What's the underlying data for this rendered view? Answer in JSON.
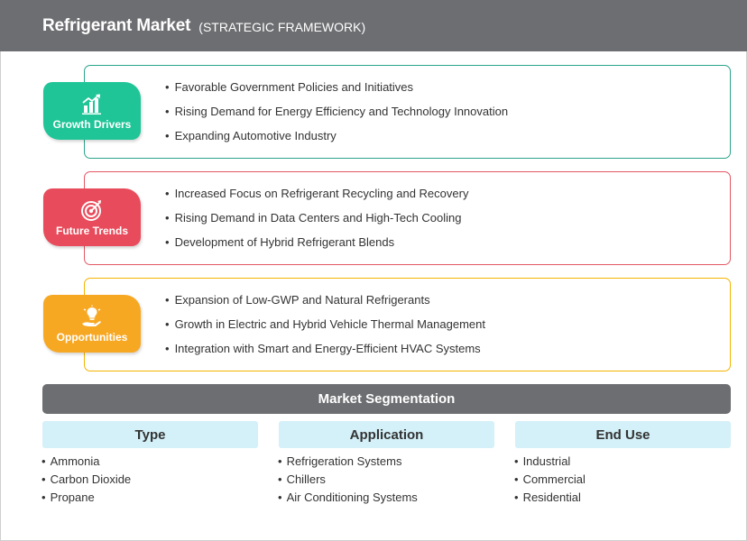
{
  "header": {
    "title": "Refrigerant Market",
    "subtitle": "(STRATEGIC FRAMEWORK)"
  },
  "sections": [
    {
      "label": "Growth Drivers",
      "icon": "growth-chart-icon",
      "color": "#1fc597",
      "border_color": "#2aa58a",
      "items": [
        "Favorable Government Policies and Initiatives",
        "Rising Demand for Energy Efficiency and Technology Innovation",
        "Expanding Automotive Industry"
      ]
    },
    {
      "label": "Future Trends",
      "icon": "target-icon",
      "color": "#e84b5b",
      "border_color": "#e35763",
      "items": [
        "Increased Focus on Refrigerant Recycling and Recovery",
        "Rising Demand in Data Centers and High-Tech Cooling",
        "Development of Hybrid Refrigerant Blends"
      ]
    },
    {
      "label": "Opportunities",
      "icon": "lightbulb-hand-icon",
      "color": "#f7a823",
      "border_color": "#f4b400",
      "items": [
        "Expansion of Low-GWP and Natural Refrigerants",
        "Growth in Electric and Hybrid Vehicle Thermal Management",
        "Integration with Smart and Energy-Efficient HVAC Systems"
      ]
    }
  ],
  "segmentation": {
    "title": "Market Segmentation",
    "columns": [
      {
        "heading": "Type",
        "items": [
          "Ammonia",
          "Carbon Dioxide",
          "Propane"
        ]
      },
      {
        "heading": "Application",
        "items": [
          "Refrigeration Systems",
          "Chillers",
          "Air Conditioning Systems"
        ]
      },
      {
        "heading": "End Use",
        "items": [
          "Industrial",
          "Commercial",
          "Residential"
        ]
      }
    ]
  }
}
